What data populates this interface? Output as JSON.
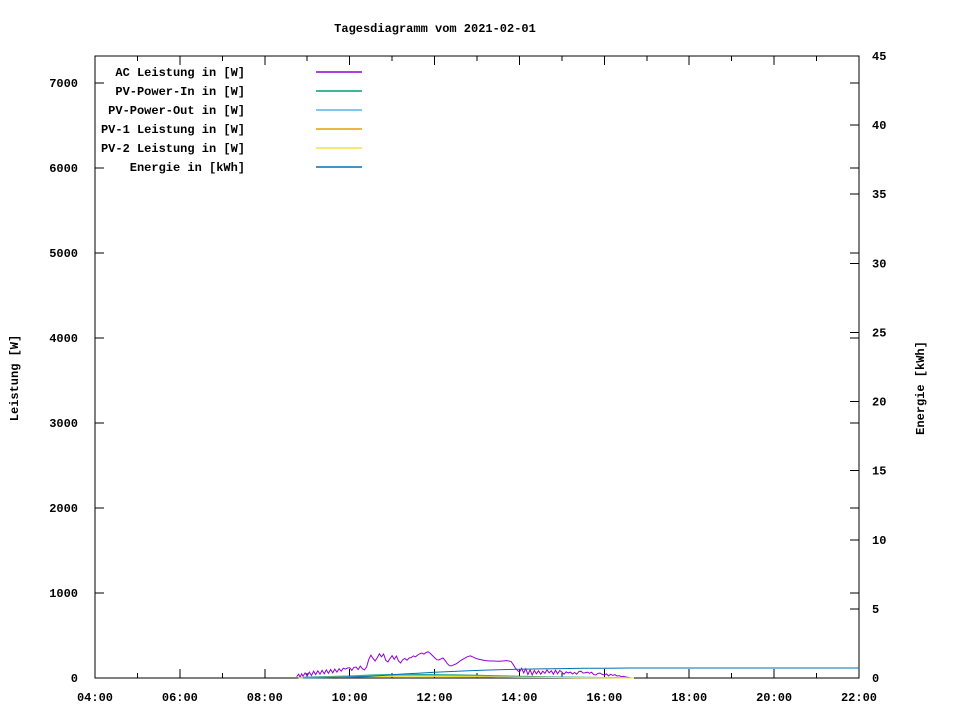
{
  "chart_data": {
    "type": "line",
    "title": "Tagesdiagramm vom 2021-02-01",
    "x_axis": {
      "range_hours": [
        4,
        22
      ],
      "major_tick_hours": [
        4,
        6,
        8,
        10,
        12,
        14,
        16,
        18,
        20,
        22
      ],
      "minor_tick_hours": [
        5,
        7,
        9,
        11,
        13,
        15,
        17,
        19,
        21
      ],
      "tick_labels": [
        "04:00",
        "06:00",
        "08:00",
        "10:00",
        "12:00",
        "14:00",
        "16:00",
        "18:00",
        "20:00",
        "22:00"
      ]
    },
    "y_left": {
      "label": "Leistung [W]",
      "range": [
        0,
        7320
      ],
      "ticks": [
        0,
        1000,
        2000,
        3000,
        4000,
        5000,
        6000,
        7000
      ],
      "tick_labels": [
        "0",
        "1000",
        "2000",
        "3000",
        "4000",
        "5000",
        "6000",
        "7000"
      ]
    },
    "y_right": {
      "label": "Energie [kWh]",
      "range": [
        0,
        45
      ],
      "ticks": [
        0,
        5,
        10,
        15,
        20,
        25,
        30,
        35,
        40,
        45
      ],
      "tick_labels": [
        "0",
        "5",
        "10",
        "15",
        "20",
        "25",
        "30",
        "35",
        "40",
        "45"
      ]
    },
    "legend_position": "top-left-inside",
    "grid": false,
    "series": [
      {
        "name": "AC Leistung in [W]",
        "color": "#9400D3",
        "axis": "left",
        "points": [
          [
            8.75,
            15
          ],
          [
            8.8,
            45
          ],
          [
            8.83,
            10
          ],
          [
            8.87,
            50
          ],
          [
            8.9,
            20
          ],
          [
            8.95,
            60
          ],
          [
            9.0,
            25
          ],
          [
            9.05,
            70
          ],
          [
            9.1,
            30
          ],
          [
            9.15,
            80
          ],
          [
            9.2,
            40
          ],
          [
            9.25,
            85
          ],
          [
            9.3,
            45
          ],
          [
            9.35,
            90
          ],
          [
            9.4,
            50
          ],
          [
            9.45,
            95
          ],
          [
            9.5,
            55
          ],
          [
            9.55,
            100
          ],
          [
            9.6,
            60
          ],
          [
            9.65,
            105
          ],
          [
            9.7,
            70
          ],
          [
            9.75,
            110
          ],
          [
            9.8,
            80
          ],
          [
            9.85,
            115
          ],
          [
            9.9,
            105
          ],
          [
            9.95,
            118
          ],
          [
            10.0,
            120
          ],
          [
            10.05,
            90
          ],
          [
            10.1,
            125
          ],
          [
            10.15,
            130
          ],
          [
            10.2,
            100
          ],
          [
            10.25,
            140
          ],
          [
            10.3,
            110
          ],
          [
            10.35,
            95
          ],
          [
            10.4,
            130
          ],
          [
            10.45,
            220
          ],
          [
            10.5,
            270
          ],
          [
            10.55,
            230
          ],
          [
            10.6,
            200
          ],
          [
            10.65,
            240
          ],
          [
            10.7,
            285
          ],
          [
            10.75,
            250
          ],
          [
            10.8,
            282
          ],
          [
            10.85,
            210
          ],
          [
            10.9,
            188
          ],
          [
            10.95,
            230
          ],
          [
            11.0,
            262
          ],
          [
            11.05,
            220
          ],
          [
            11.1,
            259
          ],
          [
            11.15,
            200
          ],
          [
            11.2,
            176
          ],
          [
            11.25,
            215
          ],
          [
            11.3,
            230
          ],
          [
            11.35,
            210
          ],
          [
            11.4,
            235
          ],
          [
            11.45,
            240
          ],
          [
            11.5,
            260
          ],
          [
            11.55,
            250
          ],
          [
            11.6,
            270
          ],
          [
            11.65,
            285
          ],
          [
            11.7,
            294
          ],
          [
            11.75,
            280
          ],
          [
            11.8,
            300
          ],
          [
            11.85,
            308
          ],
          [
            11.9,
            290
          ],
          [
            11.95,
            265
          ],
          [
            12.0,
            240
          ],
          [
            12.05,
            215
          ],
          [
            12.1,
            212
          ],
          [
            12.15,
            225
          ],
          [
            12.2,
            235
          ],
          [
            12.25,
            205
          ],
          [
            12.3,
            170
          ],
          [
            12.35,
            145
          ],
          [
            12.4,
            142
          ],
          [
            12.45,
            155
          ],
          [
            12.5,
            165
          ],
          [
            12.55,
            180
          ],
          [
            12.6,
            200
          ],
          [
            12.65,
            215
          ],
          [
            12.7,
            230
          ],
          [
            12.75,
            245
          ],
          [
            12.8,
            255
          ],
          [
            12.85,
            260
          ],
          [
            12.9,
            248
          ],
          [
            12.95,
            236
          ],
          [
            13.0,
            226
          ],
          [
            13.1,
            215
          ],
          [
            13.2,
            205
          ],
          [
            13.3,
            200
          ],
          [
            13.4,
            200
          ],
          [
            13.5,
            198
          ],
          [
            13.6,
            200
          ],
          [
            13.7,
            205
          ],
          [
            13.8,
            195
          ],
          [
            13.85,
            160
          ],
          [
            13.9,
            120
          ],
          [
            13.95,
            90
          ],
          [
            14.0,
            70
          ],
          [
            14.05,
            115
          ],
          [
            14.1,
            60
          ],
          [
            14.15,
            110
          ],
          [
            14.2,
            40
          ],
          [
            14.25,
            95
          ],
          [
            14.3,
            35
          ],
          [
            14.35,
            90
          ],
          [
            14.4,
            50
          ],
          [
            14.45,
            85
          ],
          [
            14.5,
            45
          ],
          [
            14.55,
            80
          ],
          [
            14.6,
            55
          ],
          [
            14.65,
            95
          ],
          [
            14.7,
            60
          ],
          [
            14.75,
            85
          ],
          [
            14.8,
            45
          ],
          [
            14.85,
            92
          ],
          [
            14.9,
            50
          ],
          [
            14.95,
            88
          ],
          [
            15.0,
            70
          ],
          [
            15.05,
            45
          ],
          [
            15.1,
            72
          ],
          [
            15.15,
            60
          ],
          [
            15.2,
            70
          ],
          [
            15.25,
            48
          ],
          [
            15.3,
            65
          ],
          [
            15.35,
            45
          ],
          [
            15.4,
            75
          ],
          [
            15.45,
            80
          ],
          [
            15.5,
            58
          ],
          [
            15.55,
            62
          ],
          [
            15.6,
            70
          ],
          [
            15.65,
            55
          ],
          [
            15.7,
            68
          ],
          [
            15.75,
            40
          ],
          [
            15.8,
            35
          ],
          [
            15.85,
            55
          ],
          [
            15.9,
            58
          ],
          [
            15.95,
            42
          ],
          [
            16.0,
            35
          ],
          [
            16.05,
            48
          ],
          [
            16.1,
            25
          ],
          [
            16.15,
            45
          ],
          [
            16.2,
            30
          ],
          [
            16.25,
            40
          ],
          [
            16.3,
            22
          ],
          [
            16.35,
            28
          ],
          [
            16.4,
            15
          ],
          [
            16.45,
            20
          ],
          [
            16.5,
            12
          ],
          [
            16.55,
            8
          ],
          [
            16.6,
            3
          ]
        ]
      },
      {
        "name": "PV-Power-In in [W]",
        "color": "#009E73",
        "axis": "left",
        "points": [
          [
            8.8,
            0
          ],
          [
            9.0,
            12
          ],
          [
            9.5,
            18
          ],
          [
            10.0,
            24
          ],
          [
            10.5,
            35
          ],
          [
            11.0,
            40
          ],
          [
            11.5,
            42
          ],
          [
            12.0,
            40
          ],
          [
            12.5,
            36
          ],
          [
            13.0,
            32
          ],
          [
            13.5,
            26
          ],
          [
            14.0,
            20
          ],
          [
            14.5,
            16
          ],
          [
            15.0,
            12
          ],
          [
            15.5,
            9
          ],
          [
            16.0,
            6
          ],
          [
            16.4,
            3
          ],
          [
            16.7,
            0
          ]
        ]
      },
      {
        "name": "PV-Power-Out in [W]",
        "color": "#56B4E9",
        "axis": "left",
        "points": [
          [
            8.8,
            0
          ],
          [
            9.0,
            8
          ],
          [
            9.5,
            13
          ],
          [
            10.0,
            18
          ],
          [
            10.5,
            28
          ],
          [
            11.0,
            33
          ],
          [
            11.5,
            35
          ],
          [
            12.0,
            33
          ],
          [
            12.5,
            29
          ],
          [
            13.0,
            25
          ],
          [
            13.5,
            20
          ],
          [
            14.0,
            15
          ],
          [
            14.5,
            12
          ],
          [
            15.0,
            9
          ],
          [
            15.5,
            6
          ],
          [
            16.0,
            4
          ],
          [
            16.4,
            2
          ],
          [
            16.7,
            0
          ]
        ]
      },
      {
        "name": "PV-1 Leistung in [W]",
        "color": "#E69F00",
        "axis": "left",
        "points": [
          [
            8.8,
            0
          ],
          [
            9.0,
            6
          ],
          [
            10.0,
            12
          ],
          [
            10.5,
            18
          ],
          [
            11.0,
            21
          ],
          [
            11.5,
            22
          ],
          [
            12.0,
            21
          ],
          [
            12.5,
            18
          ],
          [
            13.0,
            16
          ],
          [
            13.5,
            13
          ],
          [
            14.0,
            10
          ],
          [
            14.5,
            8
          ],
          [
            15.0,
            6
          ],
          [
            15.5,
            4
          ],
          [
            16.0,
            3
          ],
          [
            16.7,
            0
          ]
        ]
      },
      {
        "name": "PV-2 Leistung in [W]",
        "color": "#F0E442",
        "axis": "left",
        "points": [
          [
            8.8,
            0
          ],
          [
            9.0,
            5
          ],
          [
            10.0,
            10
          ],
          [
            10.5,
            16
          ],
          [
            11.0,
            19
          ],
          [
            11.5,
            20
          ],
          [
            12.0,
            19
          ],
          [
            12.5,
            17
          ],
          [
            13.0,
            14
          ],
          [
            13.5,
            11
          ],
          [
            14.0,
            9
          ],
          [
            14.5,
            7
          ],
          [
            15.0,
            5
          ],
          [
            15.5,
            3
          ],
          [
            16.0,
            2
          ],
          [
            16.7,
            0
          ]
        ]
      },
      {
        "name": "Energie in [kWh]",
        "color": "#0072B2",
        "axis": "right",
        "points": [
          [
            8.9,
            0
          ],
          [
            9.5,
            0.03
          ],
          [
            10.0,
            0.07
          ],
          [
            10.4,
            0.11
          ],
          [
            10.8,
            0.19
          ],
          [
            11.2,
            0.28
          ],
          [
            11.6,
            0.34
          ],
          [
            12.0,
            0.42
          ],
          [
            12.4,
            0.47
          ],
          [
            12.8,
            0.52
          ],
          [
            13.2,
            0.57
          ],
          [
            13.6,
            0.61
          ],
          [
            14.0,
            0.64
          ],
          [
            14.5,
            0.66
          ],
          [
            15.0,
            0.68
          ],
          [
            15.5,
            0.7
          ],
          [
            16.0,
            0.71
          ],
          [
            16.6,
            0.72
          ],
          [
            22.0,
            0.72
          ]
        ]
      }
    ]
  }
}
